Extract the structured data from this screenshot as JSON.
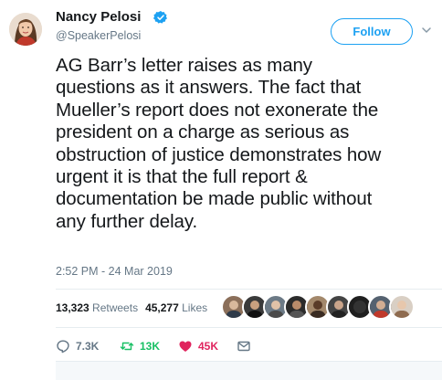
{
  "author": {
    "name": "Nancy Pelosi",
    "handle": "@SpeakerPelosi",
    "verified": true
  },
  "follow_button": {
    "label": "Follow"
  },
  "tweet": {
    "lines": [
      "AG Barr’s letter raises as many",
      "questions as it answers. The fact that",
      "Mueller’s report does not exonerate the",
      "president on a charge as serious as",
      "obstruction of justice demonstrates how",
      "urgent it is that the full report &",
      "documentation be made public without",
      "any further delay."
    ],
    "timestamp": "2:52 PM - 24 Mar 2019"
  },
  "stats": {
    "retweets_count": "13,323",
    "retweets_label": "Retweets",
    "likes_count": "45,277",
    "likes_label": "Likes"
  },
  "actions": {
    "reply_count": "7.3K",
    "retweet_count": "13K",
    "like_count": "45K"
  },
  "colors": {
    "accent": "#1da1f2",
    "retweet": "#17bf63",
    "like": "#e0245e",
    "muted": "#657786"
  }
}
